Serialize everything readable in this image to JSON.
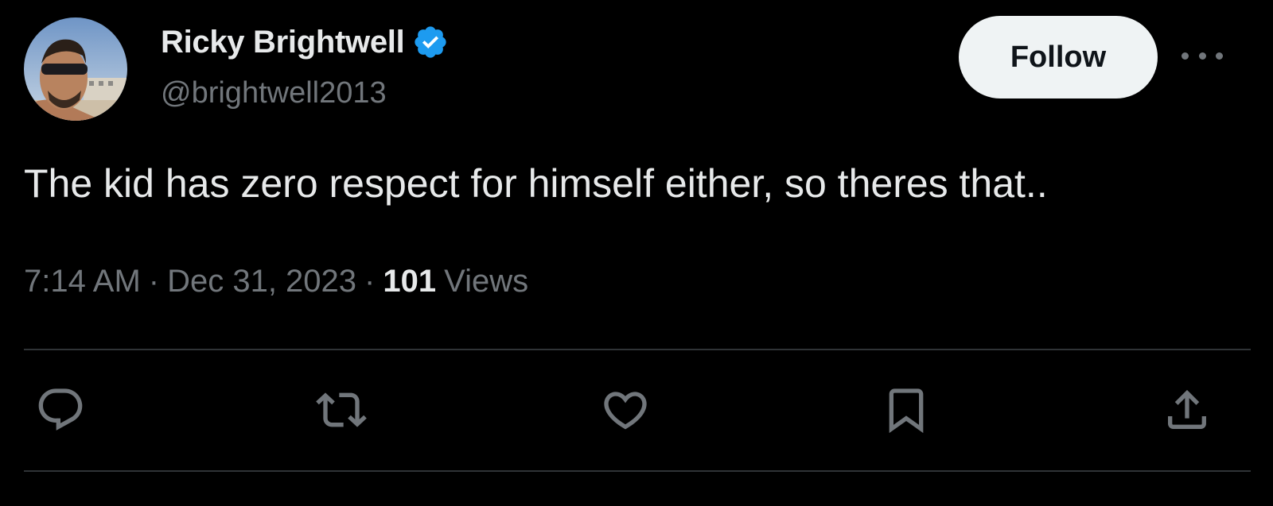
{
  "author": {
    "display_name": "Ricky Brightwell",
    "handle": "@brightwell2013",
    "verified": true,
    "verified_icon": "verified-badge-icon",
    "verified_color": "#1d9bf0"
  },
  "follow_button": {
    "label": "Follow"
  },
  "more_menu": {
    "icon": "more-horizontal-icon"
  },
  "tweet": {
    "text": "The kid has zero respect for himself either, so theres that.."
  },
  "meta": {
    "time": "7:14 AM",
    "separator": "·",
    "date": "Dec 31, 2023",
    "views_count": "101",
    "views_label": "Views"
  },
  "actions": [
    {
      "name": "reply",
      "icon": "reply-icon"
    },
    {
      "name": "retweet",
      "icon": "retweet-icon"
    },
    {
      "name": "like",
      "icon": "heart-icon"
    },
    {
      "name": "bookmark",
      "icon": "bookmark-icon"
    },
    {
      "name": "share",
      "icon": "share-icon"
    }
  ],
  "colors": {
    "background": "#000000",
    "primary_text": "#e7e9ea",
    "secondary_text": "#71767b",
    "divider": "#2f3336",
    "follow_bg": "#eff3f4"
  }
}
